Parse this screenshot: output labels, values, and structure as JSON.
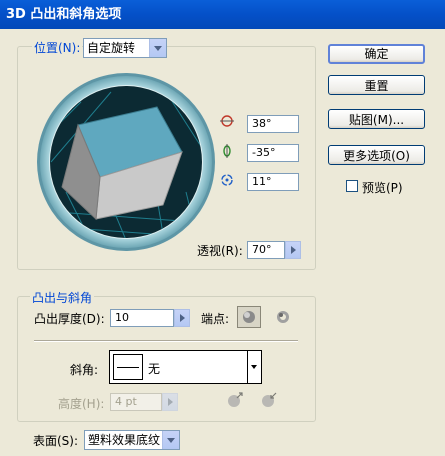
{
  "dialog": {
    "title": "3D 凸出和斜角选项"
  },
  "position": {
    "label": "位置(N):",
    "preset": "自定旋转",
    "rotation_x": "38°",
    "rotation_y": "-35°",
    "rotation_z": "11°",
    "perspective_label": "透视(R):",
    "perspective": "70°"
  },
  "buttons": {
    "ok": "确定",
    "reset": "重置",
    "map_art": "贴图(M)...",
    "more_options": "更多选项(O)"
  },
  "preview": {
    "label": "预览(P)",
    "checked": false
  },
  "extrude": {
    "section_label": "凸出与斜角",
    "depth_label": "凸出厚度(D):",
    "depth": "10",
    "cap_label": "端点:",
    "bevel_label": "斜角:",
    "bevel": "无",
    "height_label": "高度(H):",
    "height": "4 pt"
  },
  "surface": {
    "label": "表面(S):",
    "value": "塑料效果底纹"
  }
}
